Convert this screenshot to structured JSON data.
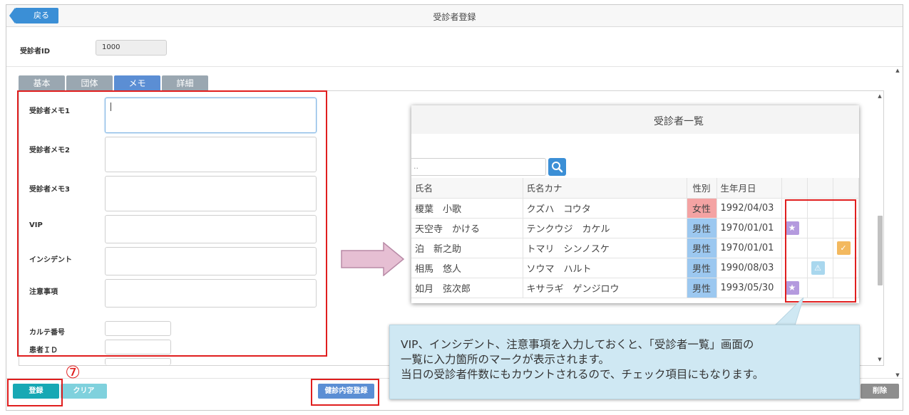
{
  "header": {
    "back_label": "戻る",
    "title": "受診者登録"
  },
  "patient_id": {
    "label": "受診者ID",
    "value": "1000"
  },
  "tabs": [
    {
      "label": "基本",
      "active": false
    },
    {
      "label": "団体",
      "active": false
    },
    {
      "label": "メモ",
      "active": true
    },
    {
      "label": "詳細",
      "active": false
    }
  ],
  "fields": {
    "memo1": "受診者メモ1",
    "memo2": "受診者メモ2",
    "memo3": "受診者メモ3",
    "vip": "VIP",
    "incident": "インシデント",
    "caution": "注意事項",
    "chart_no": "カルテ番号",
    "patient_id": "患者ＩＤ"
  },
  "footer": {
    "register": "登録",
    "clear": "クリア",
    "exam_register": "健診内容登録",
    "delete": "削除",
    "step_marker": "⑦"
  },
  "popup": {
    "title": "受診者一覧",
    "search_value": "..",
    "columns": [
      "氏名",
      "氏名カナ",
      "性別",
      "生年月日"
    ],
    "rows": [
      {
        "name": "榎葉　小歌",
        "kana": "クズハ　コウタ",
        "sex": "女性",
        "dob": "1992/04/03",
        "vip": false,
        "incident": false,
        "caution": false
      },
      {
        "name": "天空寺　かける",
        "kana": "テンクウジ　カケル",
        "sex": "男性",
        "dob": "1970/01/01",
        "vip": true,
        "incident": false,
        "caution": false
      },
      {
        "name": "泊　新之助",
        "kana": "トマリ　シンノスケ",
        "sex": "男性",
        "dob": "1970/01/01",
        "vip": false,
        "incident": false,
        "caution": true
      },
      {
        "name": "相馬　悠人",
        "kana": "ソウマ　ハルト",
        "sex": "男性",
        "dob": "1990/08/03",
        "vip": false,
        "incident": true,
        "caution": false
      },
      {
        "name": "如月　弦次郎",
        "kana": "キサラギ　ゲンジロウ",
        "sex": "男性",
        "dob": "1993/05/30",
        "vip": true,
        "incident": false,
        "caution": false
      }
    ]
  },
  "callout": {
    "line1": "VIP、インシデント、注意事項を入力しておくと、「受診者一覧」画面の",
    "line2": "一覧に入力箇所のマークが表示されます。",
    "line3": "当日の受診者件数にもカウントされるので、チェック項目にもなります。"
  },
  "colors": {
    "primary": "#3b8fd6",
    "register": "#17a8b4",
    "clear": "#7fd1dd",
    "female": "#f4a3a3",
    "male": "#9cc8f0",
    "vip_mark": "#b49ade",
    "incident_mark": "#a9d7ee",
    "caution_mark": "#f3b95f",
    "highlight": "#e01e1e"
  }
}
